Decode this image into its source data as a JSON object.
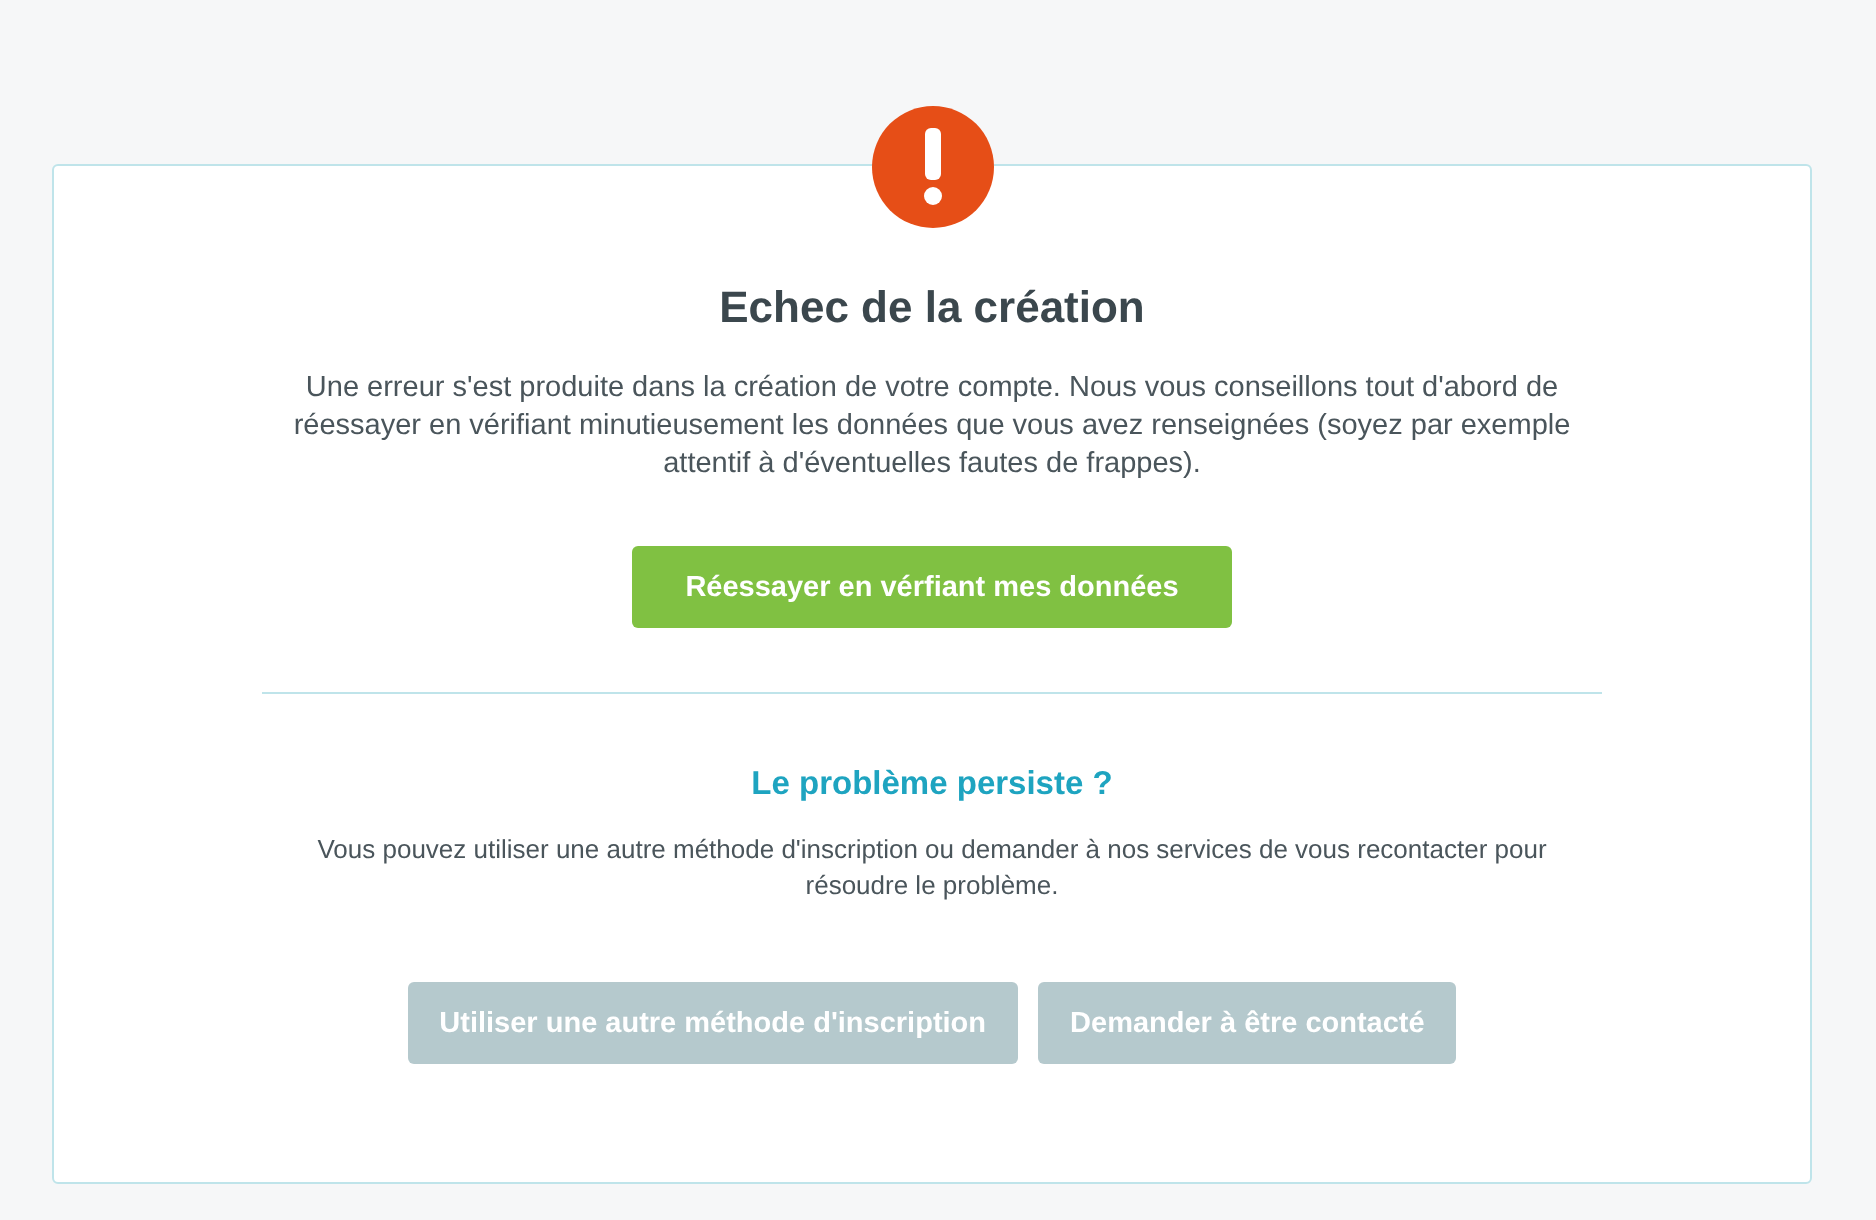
{
  "dialog": {
    "title": "Echec de la création",
    "message": "Une erreur s'est produite dans la création de votre compte. Nous vous conseillons tout d'abord de réessayer en vérifiant minutieusement les données que vous avez renseignées (soyez par exemple attentif à d'éventuelles fautes de frappes).",
    "primary_buttons": [
      {
        "label": "Réessayer en vérfiant mes données",
        "kind": "primary"
      }
    ],
    "help": {
      "title": "Le problème persiste ?",
      "message": "Vous pouvez utiliser une autre méthode d'inscription ou demander à nos services de vous recontacter pour résoudre le problème.",
      "buttons": [
        {
          "label": "Utiliser une autre méthode d'inscription",
          "kind": "secondary"
        },
        {
          "label": "Demander à être contacté",
          "kind": "secondary"
        }
      ]
    }
  }
}
